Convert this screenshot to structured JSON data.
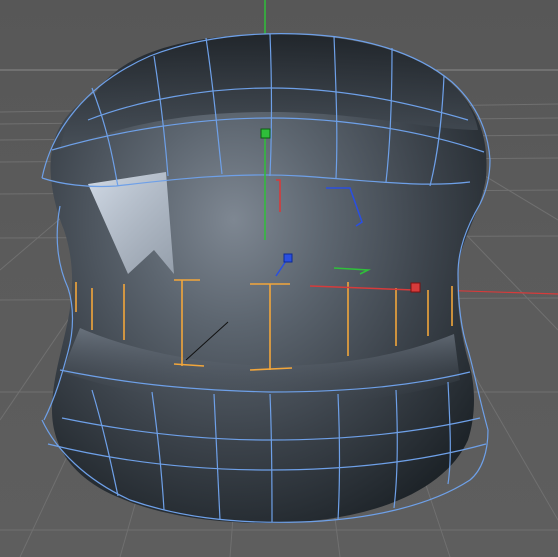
{
  "viewport": {
    "background": "#5d5d5d",
    "grid_color": "#6e6e6e",
    "wireframe_color": "#6ea0e8",
    "selection_color": "#f2a63b",
    "axis_colors": {
      "x": "#d63b3b",
      "y": "#2fbf3a",
      "z": "#2a4fe0"
    }
  },
  "object": {
    "type": "subdivided-mesh",
    "shading": "gouraud-dark-gray",
    "selected_edge_loop": true
  },
  "manipulator": {
    "handles": [
      "x-handle",
      "y-handle",
      "z-handle"
    ],
    "handle_icons": [
      "red-square",
      "green-square",
      "blue-square"
    ]
  }
}
